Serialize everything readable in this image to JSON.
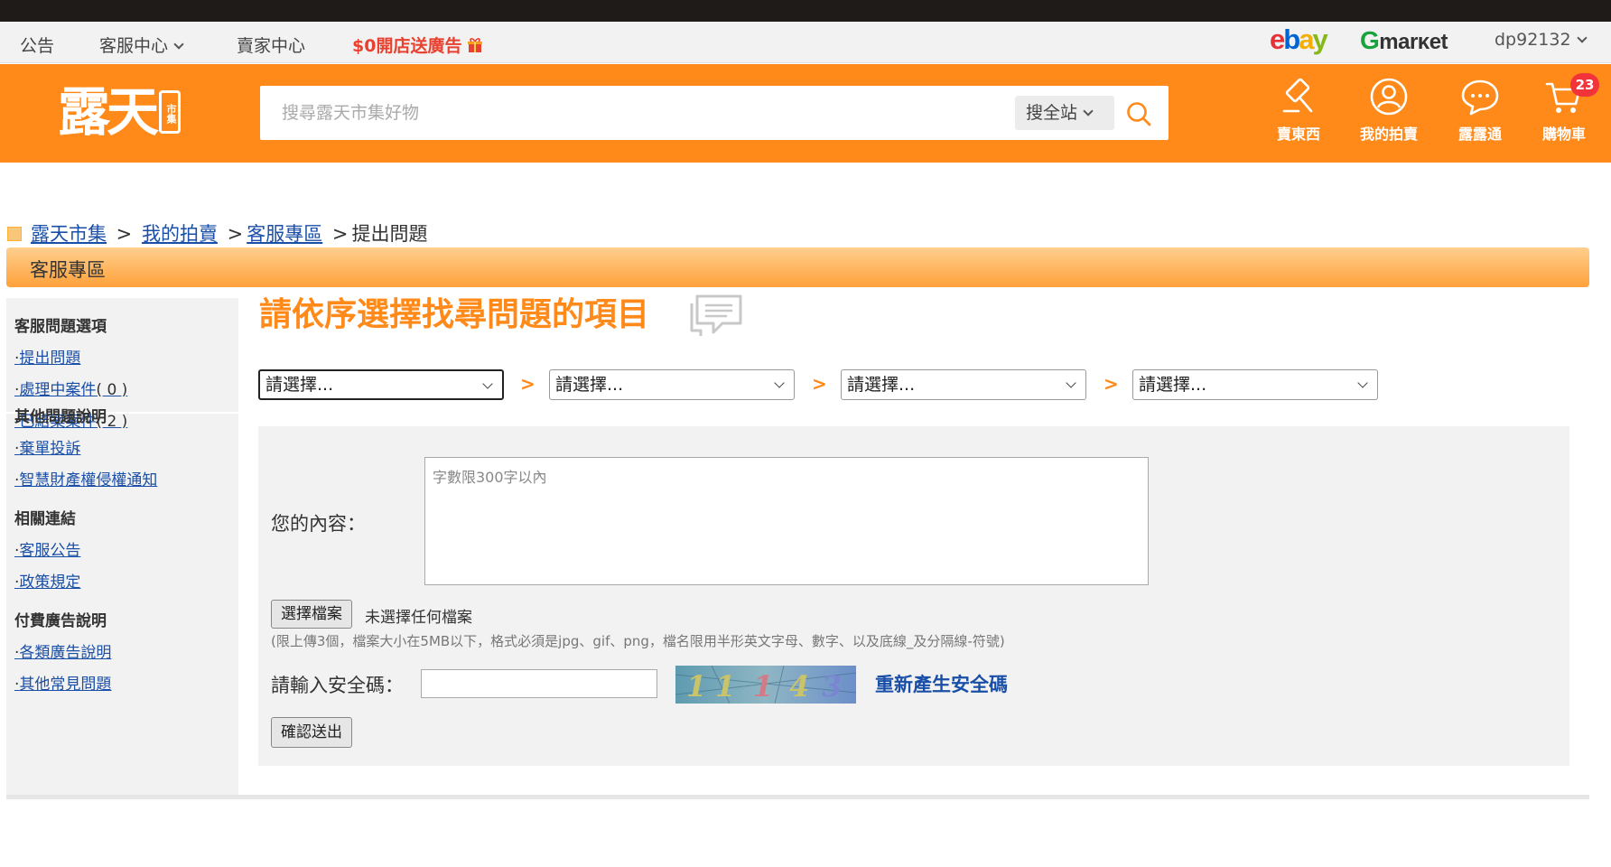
{
  "topbar": {
    "announcement": "公告",
    "customer_center": "客服中心",
    "seller_center": "賣家中心",
    "promo": "$0開店送廣告",
    "partners": {
      "ebay": [
        "e",
        "b",
        "a",
        "y"
      ],
      "gmarket_g": "G",
      "gmarket_rest": "marκet"
    },
    "user": "dp92132"
  },
  "header": {
    "logo_text": "露天",
    "logo_tag": "市集",
    "search_placeholder": "搜尋露天市集好物",
    "search_scope": "搜全站",
    "icons": [
      {
        "icon": "gavel-icon",
        "label": "賣東西"
      },
      {
        "icon": "user-icon",
        "label": "我的拍賣"
      },
      {
        "icon": "chat-icon",
        "label": "露露通"
      },
      {
        "icon": "cart-icon",
        "label": "購物車"
      }
    ],
    "cart_count": "23"
  },
  "breadcrumb": {
    "items": [
      "露天市集",
      "我的拍賣",
      "客服專區"
    ],
    "sep1": " > ",
    "sep2": " >",
    "sep3": " >",
    "current": "提出問題"
  },
  "section_title": "客服專區",
  "sidebar": {
    "groups": [
      {
        "title": "客服問題選項",
        "links": [
          {
            "label": "提出問題"
          },
          {
            "label": "處理中案件",
            "count": "( 0 )"
          },
          {
            "label": "已結案案件",
            "count": "( 2 )"
          }
        ]
      },
      {
        "title": "其他問題說明",
        "links": [
          {
            "label": "棄單投訴"
          },
          {
            "label": "智慧財產權侵權通知"
          }
        ]
      },
      {
        "title": "相關連結",
        "links": [
          {
            "label": "客服公告"
          },
          {
            "label": "政策規定"
          }
        ]
      },
      {
        "title": "付費廣告說明",
        "links": [
          {
            "label": "各類廣告說明"
          },
          {
            "label": "其他常見問題"
          }
        ]
      }
    ],
    "bullet": "‧"
  },
  "main": {
    "title": "請依序選擇找尋問題的項目",
    "selects": [
      "請選擇...",
      "請選擇...",
      "請選擇...",
      "請選擇..."
    ],
    "arrow": ">"
  },
  "form": {
    "content_label": "您的內容：",
    "content_placeholder": "字數限300字以內",
    "file_button": "選擇檔案",
    "file_status": "未選擇任何檔案",
    "upload_note": "(限上傳3個，檔案大小在5MB以下，格式必須是jpg、gif、png，檔名限用半形英文字母、數字、以及底線_及分隔線-符號)",
    "captcha_label": "請輸入安全碼：",
    "captcha_value": "",
    "captcha_digits": [
      "1",
      "1",
      "1",
      "4",
      "3"
    ],
    "refresh_label": "重新產生安全碼",
    "submit_label": "確認送出"
  },
  "colors": {
    "brand_orange": "#ff8a1a",
    "link_blue": "#1a4fa8",
    "promo_red": "#e8412f",
    "badge_red": "#f2343a"
  }
}
